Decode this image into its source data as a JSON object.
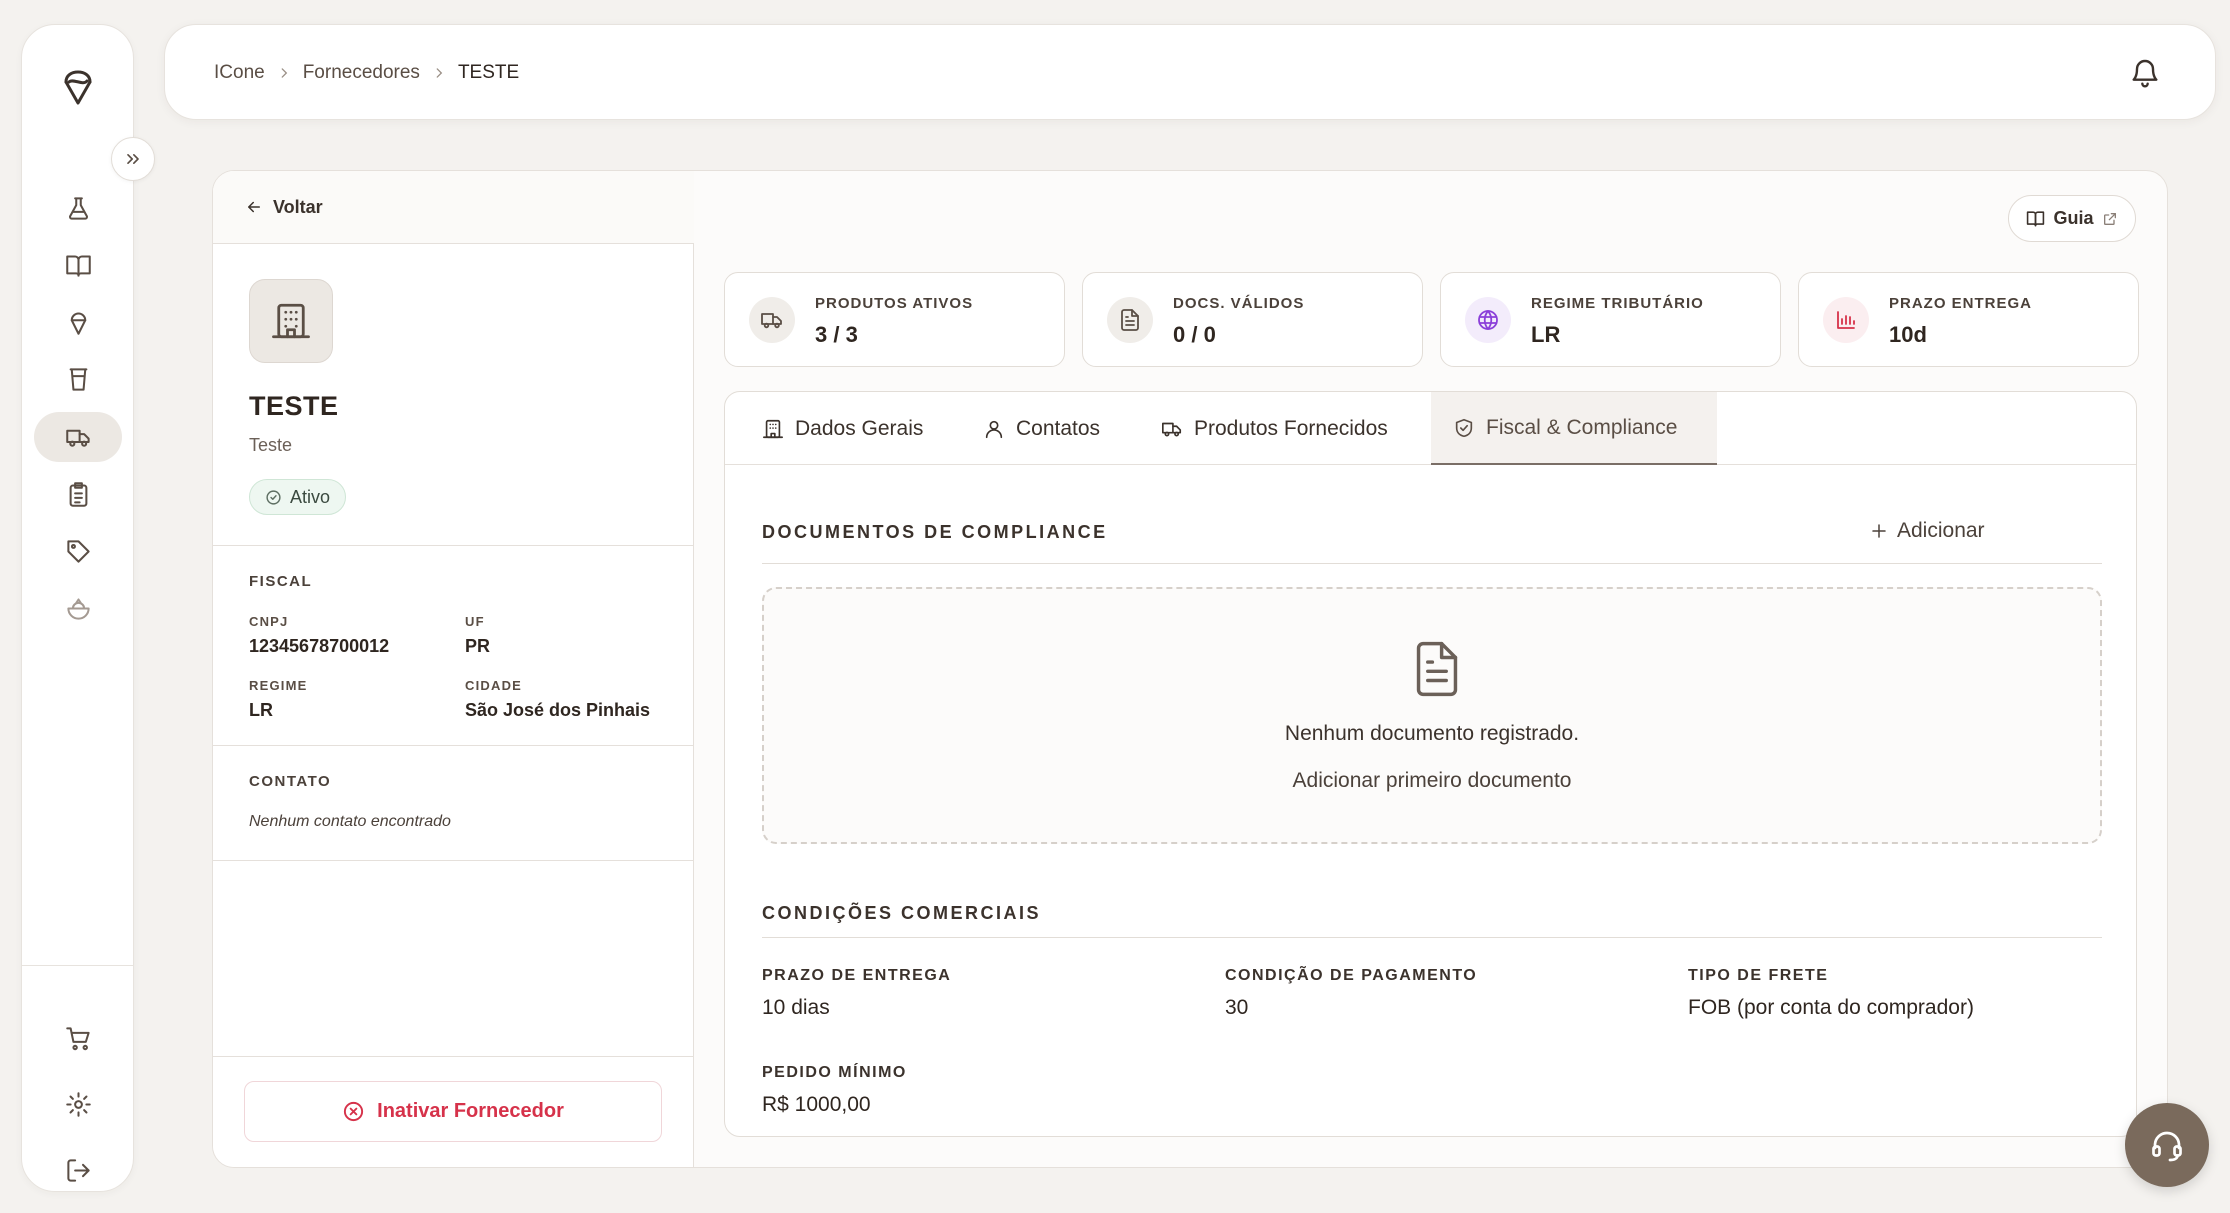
{
  "sidebar": {
    "logo_icon": "ice-cream-logo-icon",
    "items": [
      {
        "name": "flask-icon",
        "active": false
      },
      {
        "name": "book-icon",
        "active": false
      },
      {
        "name": "ice-cream-icon",
        "active": false
      },
      {
        "name": "cup-icon",
        "active": false
      },
      {
        "name": "truck-icon",
        "active": true
      },
      {
        "name": "clipboard-icon",
        "active": false
      },
      {
        "name": "tag-icon",
        "active": false
      },
      {
        "name": "bowl-icon",
        "active": false
      }
    ],
    "bottom_items": [
      {
        "name": "cart-icon"
      },
      {
        "name": "gear-icon"
      },
      {
        "name": "logout-icon"
      }
    ]
  },
  "header": {
    "breadcrumb": [
      "ICone",
      "Fornecedores",
      "TESTE"
    ]
  },
  "left_panel": {
    "back_label": "Voltar",
    "name": "TESTE",
    "subtitle": "Teste",
    "status": "Ativo",
    "fiscal": {
      "title": "FISCAL",
      "cnpj_label": "CNPJ",
      "cnpj": "12345678700012",
      "uf_label": "UF",
      "uf": "PR",
      "regime_label": "REGIME",
      "regime": "LR",
      "cidade_label": "CIDADE",
      "cidade": "São José dos Pinhais"
    },
    "contato": {
      "title": "CONTATO",
      "empty": "Nenhum contato encontrado"
    },
    "inactivate_label": "Inativar Fornecedor"
  },
  "guide_label": "Guia",
  "stats": [
    {
      "label": "PRODUTOS ATIVOS",
      "value": "3 / 3",
      "icon": "truck-icon"
    },
    {
      "label": "DOCS. VÁLIDOS",
      "value": "0 / 0",
      "icon": "document-icon"
    },
    {
      "label": "REGIME TRIBUTÁRIO",
      "value": "LR",
      "icon": "globe-icon",
      "icon_color": "#8b3fd9",
      "icon_bg": "#f3ecfb"
    },
    {
      "label": "PRAZO ENTREGA",
      "value": "10d",
      "icon": "bar-chart-icon",
      "icon_color": "#d6324a",
      "icon_bg": "#fbeef0"
    }
  ],
  "tabs": [
    {
      "label": "Dados Gerais",
      "icon": "building-icon",
      "active": false
    },
    {
      "label": "Contatos",
      "icon": "user-icon",
      "active": false
    },
    {
      "label": "Produtos Fornecidos",
      "icon": "truck-icon",
      "active": false
    },
    {
      "label": "Fiscal & Compliance",
      "icon": "shield-check-icon",
      "active": true
    }
  ],
  "compliance": {
    "title": "DOCUMENTOS DE COMPLIANCE",
    "add_label": "Adicionar",
    "empty_text": "Nenhum documento registrado.",
    "empty_link": "Adicionar primeiro documento"
  },
  "commercial": {
    "title": "CONDIÇÕES COMERCIAIS",
    "prazo_label": "PRAZO DE ENTREGA",
    "prazo": "10 dias",
    "pagamento_label": "CONDIÇÃO DE PAGAMENTO",
    "pagamento": "30",
    "frete_label": "TIPO DE FRETE",
    "frete": "FOB (por conta do comprador)",
    "pedido_label": "PEDIDO MÍNIMO",
    "pedido": "R$ 1000,00"
  },
  "support_icon": "headset-icon",
  "colors": {
    "accent": "#7a6a5c",
    "danger": "#d6324a",
    "success_bg": "#eef7f1",
    "background": "#f4f2ef"
  }
}
